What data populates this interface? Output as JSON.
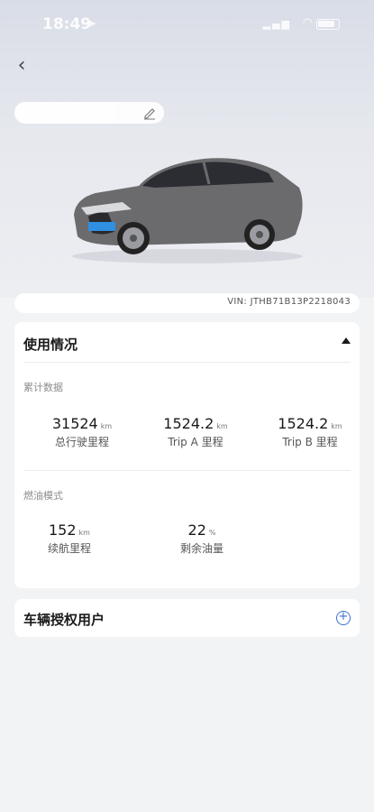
{
  "status_bar": {
    "time": "18:49",
    "location_icon": "location-arrow-icon",
    "signal_icon": "signal-icon",
    "wifi_icon": "wifi-icon",
    "battery_icon": "battery-icon"
  },
  "header": {
    "back_icon": "chevron-left-icon",
    "edit_icon": "pencil-icon"
  },
  "vin": "VIN: JTHB71B13P2218043",
  "usage": {
    "title": "使用情况",
    "collapse_icon": "triangle-up-icon",
    "cumulative": {
      "label": "累计数据",
      "stats": [
        {
          "value": "31524",
          "unit": "km",
          "label": "总行驶里程"
        },
        {
          "value": "1524.2",
          "unit": "km",
          "label": "Trip A 里程"
        },
        {
          "value": "1524.2",
          "unit": "km",
          "label": "Trip B 里程"
        }
      ]
    },
    "fuel": {
      "label": "燃油模式",
      "stats": [
        {
          "value": "152",
          "unit": "km",
          "label": "续航里程"
        },
        {
          "value": "22",
          "unit": "%",
          "label": "剩余油量"
        }
      ]
    }
  },
  "authorized": {
    "title": "车辆授权用户",
    "add_icon": "plus-circle-icon"
  },
  "colors": {
    "accent": "#3a6fd8",
    "background": "#f2f3f5",
    "card": "#ffffff",
    "car_body": "#6b6b6e"
  }
}
